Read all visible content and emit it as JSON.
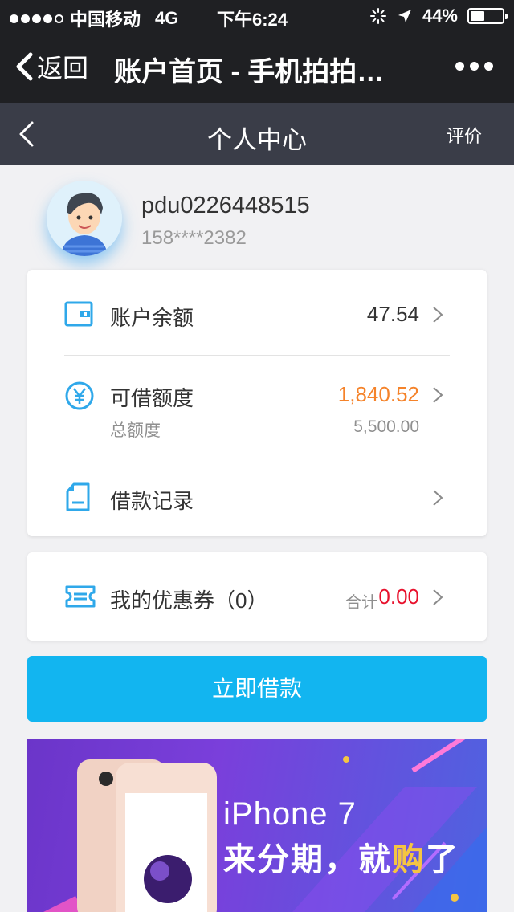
{
  "status_bar": {
    "carrier": "中国移动",
    "network": "4G",
    "time": "下午6:24",
    "battery": "44%",
    "battery_level": 0.44
  },
  "wechat_nav": {
    "back_label": "返回",
    "title": "账户首页 - 手机拍拍…",
    "more_icon": "more-dots-icon"
  },
  "page_header": {
    "title": "个人中心",
    "rate_label": "评价"
  },
  "profile": {
    "username": "pdu0226448515",
    "phone": "158****2382"
  },
  "account_card": {
    "balance": {
      "label": "账户余额",
      "value": "47.54",
      "icon": "wallet-icon"
    },
    "credit": {
      "label": "可借额度",
      "value": "1,840.52",
      "sub_label": "总额度",
      "sub_value": "5,500.00",
      "icon": "yen-circle-icon"
    },
    "records": {
      "label": "借款记录",
      "icon": "document-icon"
    }
  },
  "coupon_card": {
    "label": "我的优惠券（0）",
    "total_label": "合计",
    "total_value": "0.00",
    "icon": "ticket-icon"
  },
  "borrow_button": "立即借款",
  "banner": {
    "line1": "iPhone 7",
    "line2_a": "来分期，就",
    "line2_b": "购",
    "line2_c": "了"
  },
  "colors": {
    "accent": "#12b5f0",
    "credit": "#f5832a",
    "total": "#e8112d",
    "header_dark": "#3a3d48"
  }
}
